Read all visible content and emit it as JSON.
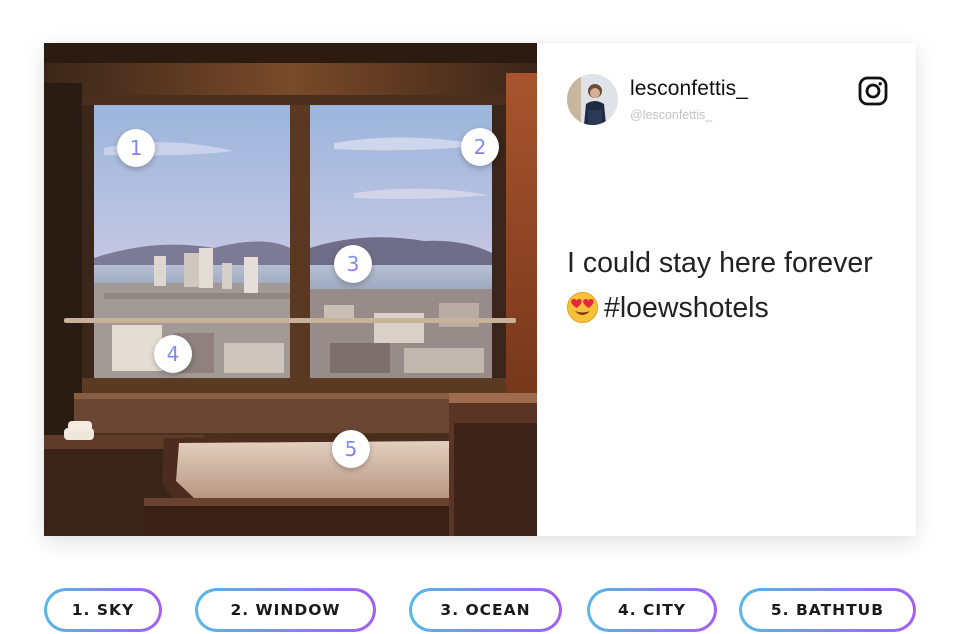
{
  "post": {
    "username": "lesconfettis_",
    "handle": "@lesconfettis_",
    "caption_line1": "I could stay here forever",
    "caption_line2": "#loewshotels",
    "emoji": "heart-eyes-emoji",
    "platform_icon": "instagram-icon"
  },
  "markers": [
    "1",
    "2",
    "3",
    "4",
    "5"
  ],
  "tags": [
    {
      "label": "1. SKY"
    },
    {
      "label": "2. WINDOW"
    },
    {
      "label": "3. OCEAN"
    },
    {
      "label": "4. CITY"
    },
    {
      "label": "5. BATHTUB"
    }
  ],
  "colors": {
    "gradient_start": "#56b8ea",
    "gradient_end": "#a45ff0"
  }
}
